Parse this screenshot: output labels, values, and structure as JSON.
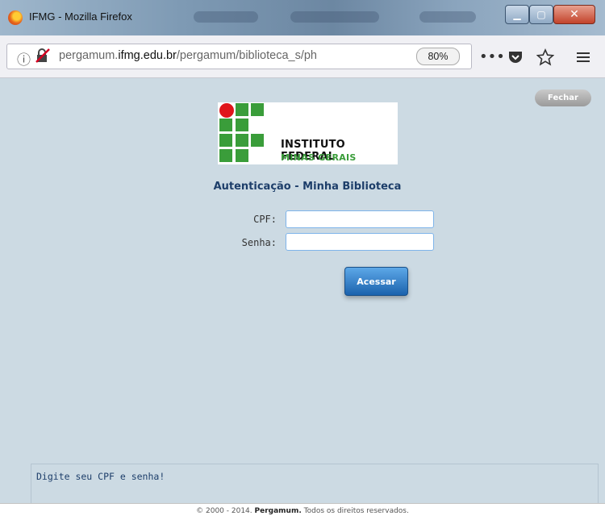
{
  "window": {
    "title": "IFMG - Mozilla Firefox",
    "min_label": "▁",
    "max_label": "▢",
    "close_label": "✕"
  },
  "toolbar": {
    "url_prefix": "pergamum.",
    "url_domain": "ifmg.edu.br",
    "url_path": "/pergamum/biblioteca_s/ph",
    "zoom": "80%",
    "more_label": "•••"
  },
  "page": {
    "close_label": "Fechar",
    "logo_line1": "INSTITUTO FEDERAL",
    "logo_line2": "MINAS GERAIS",
    "title": "Autenticação - Minha Biblioteca",
    "cpf_label": "CPF:",
    "senha_label": "Senha:",
    "cpf_value": "",
    "senha_value": "",
    "submit_label": "Acessar",
    "message": "Digite seu CPF e senha!",
    "footer_prefix": "© 2000 - 2014.",
    "footer_brand": "Pergamum.",
    "footer_suffix": "Todos os direitos reservados."
  },
  "colors": {
    "accent": "#1b62ad",
    "logo_green": "#3a9d3a",
    "logo_red": "#e0151b",
    "title_blue": "#1d3e6a"
  }
}
